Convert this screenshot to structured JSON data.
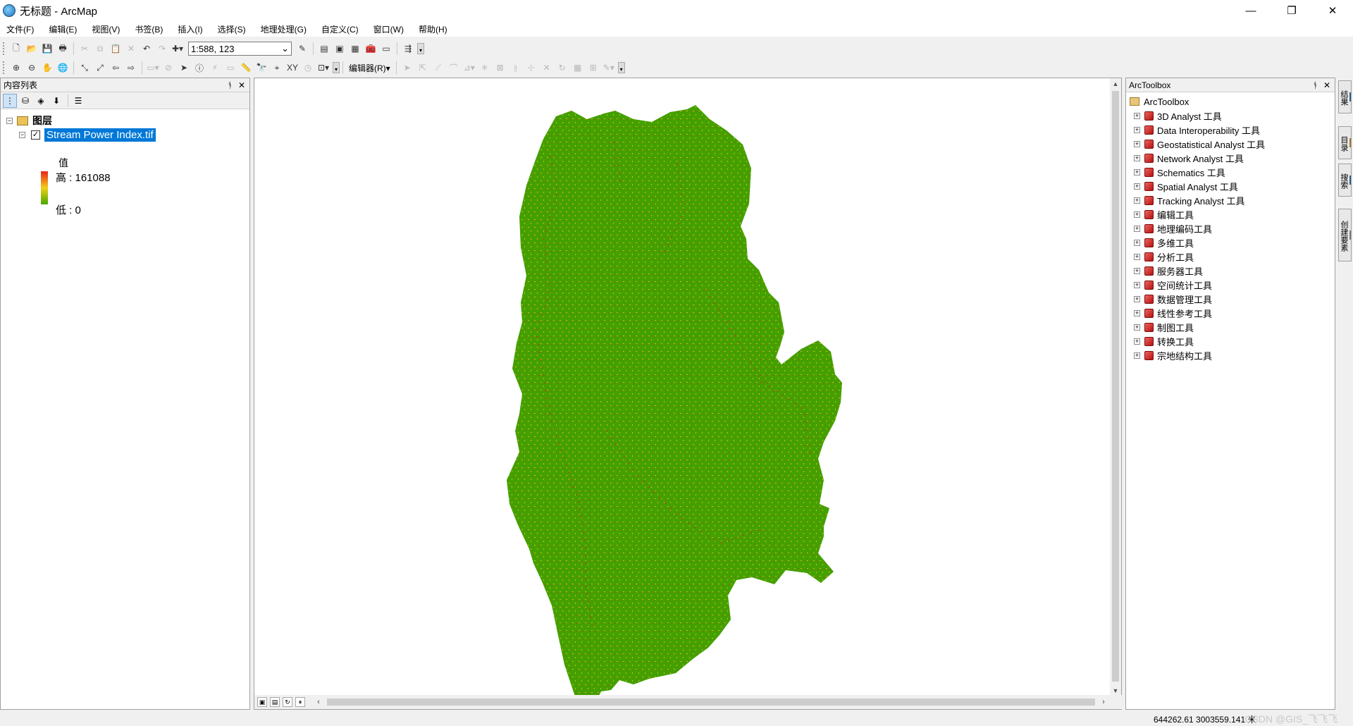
{
  "window": {
    "title": "无标题 - ArcMap",
    "minimize": "—",
    "restore": "❐",
    "close": "✕"
  },
  "menu": [
    "文件(F)",
    "编辑(E)",
    "视图(V)",
    "书签(B)",
    "插入(I)",
    "选择(S)",
    "地理处理(G)",
    "自定义(C)",
    "窗口(W)",
    "帮助(H)"
  ],
  "toolbar": {
    "scale_value": "1:588, 123",
    "editor_label": "编辑器(R)▾"
  },
  "toc": {
    "header": "内容列表",
    "pin": "ᚬ",
    "close": "✕",
    "group_label": "图层",
    "layer_name": "Stream Power Index.tif",
    "legend_title": "值",
    "legend_high": "高 : 161088",
    "legend_low": "低 : 0",
    "legend_colors": [
      "#e8241c",
      "#f2cf1a",
      "#47a800"
    ]
  },
  "map": {
    "fill_color": "#44a000",
    "accent_color": "#c4c21a",
    "hot_color": "#c8341b"
  },
  "arctoolbox": {
    "header": "ArcToolbox",
    "root": "ArcToolbox",
    "items": [
      "3D Analyst 工具",
      "Data Interoperability 工具",
      "Geostatistical Analyst 工具",
      "Network Analyst 工具",
      "Schematics 工具",
      "Spatial Analyst 工具",
      "Tracking Analyst 工具",
      "编辑工具",
      "地理编码工具",
      "多维工具",
      "分析工具",
      "服务器工具",
      "空间统计工具",
      "数据管理工具",
      "线性参考工具",
      "制图工具",
      "转换工具",
      "宗地结构工具"
    ]
  },
  "side_tabs": [
    "结果",
    "目录",
    "搜索",
    "创建要素"
  ],
  "status": {
    "coords": "644262.61  3003559.141 米",
    "watermark": "CSDN @GIS_飞飞飞"
  }
}
